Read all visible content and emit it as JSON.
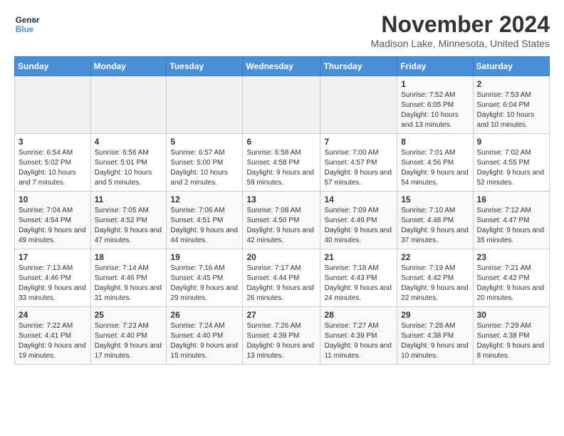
{
  "header": {
    "logo_line1": "General",
    "logo_line2": "Blue",
    "month_year": "November 2024",
    "location": "Madison Lake, Minnesota, United States"
  },
  "days_of_week": [
    "Sunday",
    "Monday",
    "Tuesday",
    "Wednesday",
    "Thursday",
    "Friday",
    "Saturday"
  ],
  "weeks": [
    [
      {
        "day": "",
        "info": ""
      },
      {
        "day": "",
        "info": ""
      },
      {
        "day": "",
        "info": ""
      },
      {
        "day": "",
        "info": ""
      },
      {
        "day": "",
        "info": ""
      },
      {
        "day": "1",
        "info": "Sunrise: 7:52 AM\nSunset: 6:05 PM\nDaylight: 10 hours and 13 minutes."
      },
      {
        "day": "2",
        "info": "Sunrise: 7:53 AM\nSunset: 6:04 PM\nDaylight: 10 hours and 10 minutes."
      }
    ],
    [
      {
        "day": "3",
        "info": "Sunrise: 6:54 AM\nSunset: 5:02 PM\nDaylight: 10 hours and 7 minutes."
      },
      {
        "day": "4",
        "info": "Sunrise: 6:56 AM\nSunset: 5:01 PM\nDaylight: 10 hours and 5 minutes."
      },
      {
        "day": "5",
        "info": "Sunrise: 6:57 AM\nSunset: 5:00 PM\nDaylight: 10 hours and 2 minutes."
      },
      {
        "day": "6",
        "info": "Sunrise: 6:58 AM\nSunset: 4:58 PM\nDaylight: 9 hours and 59 minutes."
      },
      {
        "day": "7",
        "info": "Sunrise: 7:00 AM\nSunset: 4:57 PM\nDaylight: 9 hours and 57 minutes."
      },
      {
        "day": "8",
        "info": "Sunrise: 7:01 AM\nSunset: 4:56 PM\nDaylight: 9 hours and 54 minutes."
      },
      {
        "day": "9",
        "info": "Sunrise: 7:02 AM\nSunset: 4:55 PM\nDaylight: 9 hours and 52 minutes."
      }
    ],
    [
      {
        "day": "10",
        "info": "Sunrise: 7:04 AM\nSunset: 4:54 PM\nDaylight: 9 hours and 49 minutes."
      },
      {
        "day": "11",
        "info": "Sunrise: 7:05 AM\nSunset: 4:52 PM\nDaylight: 9 hours and 47 minutes."
      },
      {
        "day": "12",
        "info": "Sunrise: 7:06 AM\nSunset: 4:51 PM\nDaylight: 9 hours and 44 minutes."
      },
      {
        "day": "13",
        "info": "Sunrise: 7:08 AM\nSunset: 4:50 PM\nDaylight: 9 hours and 42 minutes."
      },
      {
        "day": "14",
        "info": "Sunrise: 7:09 AM\nSunset: 4:49 PM\nDaylight: 9 hours and 40 minutes."
      },
      {
        "day": "15",
        "info": "Sunrise: 7:10 AM\nSunset: 4:48 PM\nDaylight: 9 hours and 37 minutes."
      },
      {
        "day": "16",
        "info": "Sunrise: 7:12 AM\nSunset: 4:47 PM\nDaylight: 9 hours and 35 minutes."
      }
    ],
    [
      {
        "day": "17",
        "info": "Sunrise: 7:13 AM\nSunset: 4:46 PM\nDaylight: 9 hours and 33 minutes."
      },
      {
        "day": "18",
        "info": "Sunrise: 7:14 AM\nSunset: 4:46 PM\nDaylight: 9 hours and 31 minutes."
      },
      {
        "day": "19",
        "info": "Sunrise: 7:16 AM\nSunset: 4:45 PM\nDaylight: 9 hours and 29 minutes."
      },
      {
        "day": "20",
        "info": "Sunrise: 7:17 AM\nSunset: 4:44 PM\nDaylight: 9 hours and 26 minutes."
      },
      {
        "day": "21",
        "info": "Sunrise: 7:18 AM\nSunset: 4:43 PM\nDaylight: 9 hours and 24 minutes."
      },
      {
        "day": "22",
        "info": "Sunrise: 7:19 AM\nSunset: 4:42 PM\nDaylight: 9 hours and 22 minutes."
      },
      {
        "day": "23",
        "info": "Sunrise: 7:21 AM\nSunset: 4:42 PM\nDaylight: 9 hours and 20 minutes."
      }
    ],
    [
      {
        "day": "24",
        "info": "Sunrise: 7:22 AM\nSunset: 4:41 PM\nDaylight: 9 hours and 19 minutes."
      },
      {
        "day": "25",
        "info": "Sunrise: 7:23 AM\nSunset: 4:40 PM\nDaylight: 9 hours and 17 minutes."
      },
      {
        "day": "26",
        "info": "Sunrise: 7:24 AM\nSunset: 4:40 PM\nDaylight: 9 hours and 15 minutes."
      },
      {
        "day": "27",
        "info": "Sunrise: 7:26 AM\nSunset: 4:39 PM\nDaylight: 9 hours and 13 minutes."
      },
      {
        "day": "28",
        "info": "Sunrise: 7:27 AM\nSunset: 4:39 PM\nDaylight: 9 hours and 11 minutes."
      },
      {
        "day": "29",
        "info": "Sunrise: 7:28 AM\nSunset: 4:38 PM\nDaylight: 9 hours and 10 minutes."
      },
      {
        "day": "30",
        "info": "Sunrise: 7:29 AM\nSunset: 4:38 PM\nDaylight: 9 hours and 8 minutes."
      }
    ]
  ]
}
